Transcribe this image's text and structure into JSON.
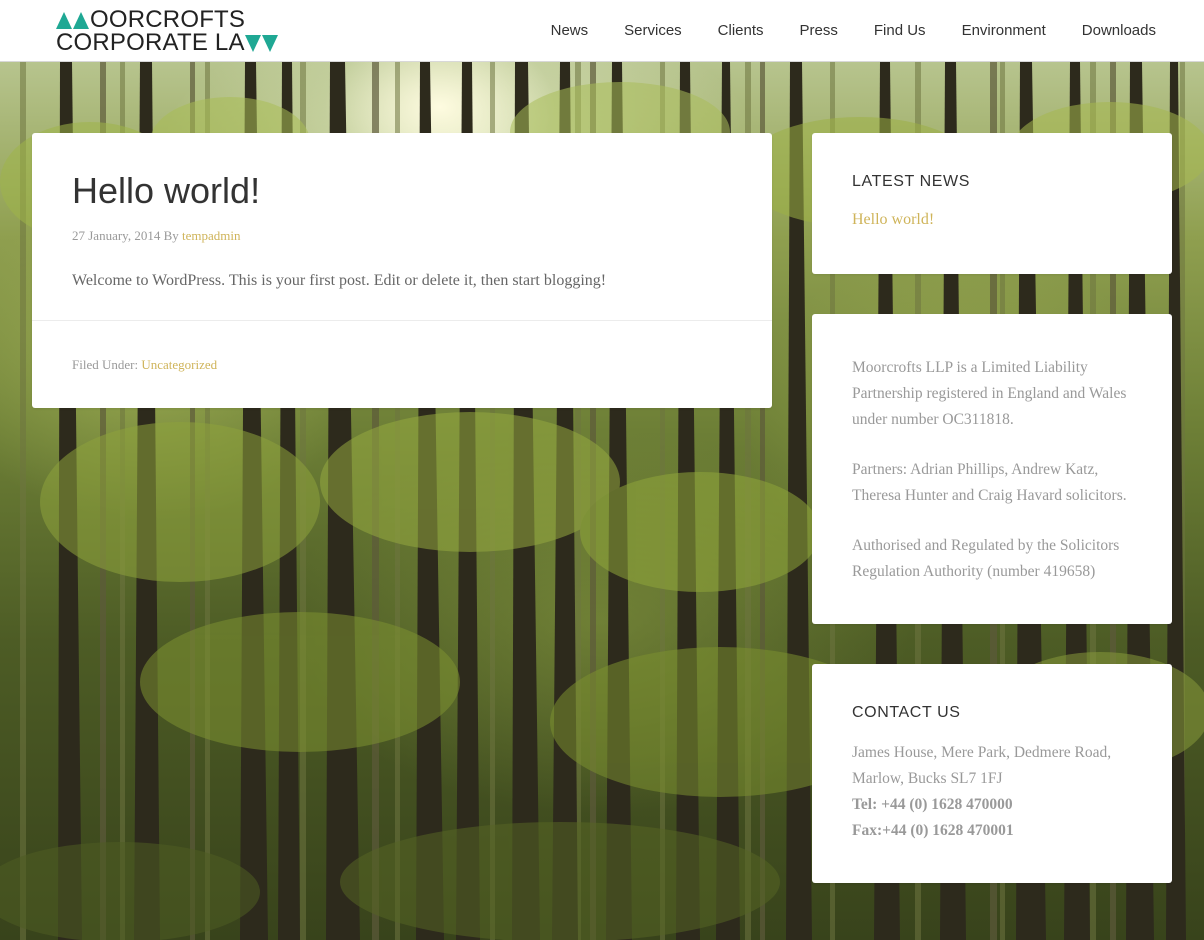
{
  "header": {
    "logo_line1": "OORCROFTS",
    "logo_line2": "CORPORATE LA",
    "nav": [
      "News",
      "Services",
      "Clients",
      "Press",
      "Find Us",
      "Environment",
      "Downloads"
    ]
  },
  "post": {
    "title": "Hello world!",
    "date": "27 January, 2014",
    "by": "By",
    "author": "tempadmin",
    "content": "Welcome to WordPress. This is your first post. Edit or delete it, then start blogging!",
    "filed_under": "Filed Under:",
    "category": "Uncategorized"
  },
  "sidebar": {
    "latest_news": {
      "title": "LATEST NEWS",
      "link": "Hello world!"
    },
    "about": {
      "paragraphs": [
        "Moorcrofts LLP is a Limited Liability Partnership registered in England and Wales under number OC311818.",
        "Partners: Adrian Phillips, Andrew Katz, Theresa Hunter and Craig Havard solicitors.",
        "Authorised and Regulated by the Solicitors Regulation Authority (number 419658)"
      ]
    },
    "contact": {
      "title": "CONTACT US",
      "address": "James House, Mere Park, Dedmere Road, Marlow, Bucks SL7 1FJ",
      "tel": "Tel: +44 (0) 1628 470000",
      "fax": "Fax:+44 (0) 1628 470001"
    }
  },
  "colors": {
    "accent_gold": "#cfb45a",
    "logo_teal": "#1fa894",
    "heading": "#333333",
    "body_text": "#666666",
    "muted_text": "#999999"
  }
}
